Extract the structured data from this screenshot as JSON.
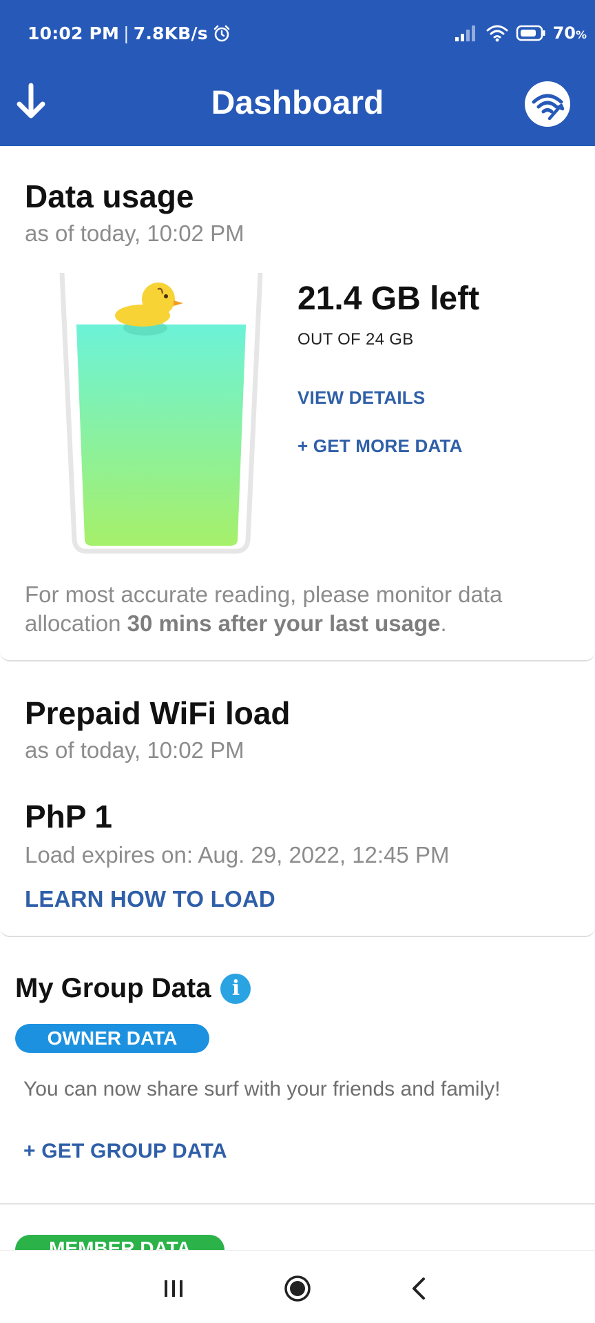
{
  "status_bar": {
    "time": "10:02 PM",
    "separator": "|",
    "net_speed": "7.8KB/s",
    "battery_percent": "70",
    "battery_unit": "%"
  },
  "header": {
    "title": "Dashboard",
    "icons": {
      "left": "download-arrow-icon",
      "right": "wifi-wrench-icon"
    }
  },
  "data_usage": {
    "title": "Data usage",
    "as_of": "as of today, 10:02 PM",
    "remaining": "21.4 GB left",
    "total": "OUT OF 24 GB",
    "remaining_fraction": 0.892,
    "view_details": "VIEW DETAILS",
    "get_more": "+ GET MORE DATA",
    "note_prefix": "For most accurate reading, please monitor data allocation ",
    "note_bold": "30 mins after your last usage",
    "note_suffix": "."
  },
  "prepaid": {
    "title": "Prepaid WiFi load",
    "as_of": "as of today, 10:02 PM",
    "amount": "PhP 1",
    "expiry": "Load expires on: Aug. 29, 2022, 12:45 PM",
    "learn": "LEARN HOW TO LOAD"
  },
  "group": {
    "title": "My Group Data",
    "info_icon": "info-icon",
    "owner_badge": "OWNER DATA",
    "description": "You can now share surf with your friends and family!",
    "get_group": "+ GET GROUP DATA",
    "member_badge": "MEMBER DATA"
  },
  "nav": {
    "icons": [
      "recents-icon",
      "home-icon",
      "back-icon"
    ]
  },
  "colors": {
    "header_blue": "#2659b8",
    "link_blue": "#2f5fa8",
    "owner_badge": "#1c91e0",
    "member_badge": "#2bb34a",
    "liquid_top": "#6cf2d8",
    "liquid_bottom": "#a6f06a"
  }
}
